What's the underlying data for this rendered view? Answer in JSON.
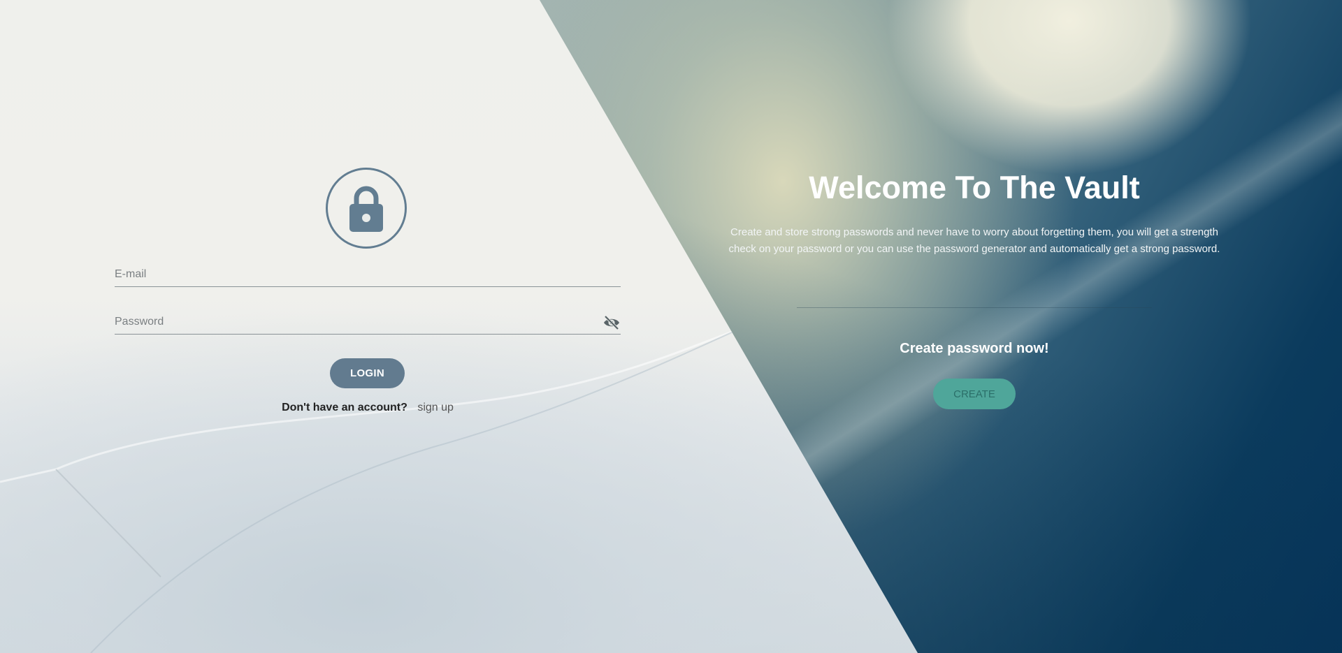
{
  "login": {
    "email_placeholder": "E-mail",
    "password_placeholder": "Password",
    "login_label": "LOGIN",
    "no_account_text": "Don't have an account?",
    "signup_label": "sign up",
    "accent_color": "#627b8f"
  },
  "welcome": {
    "title": "Welcome To The Vault",
    "description": "Create and store strong passwords and never have to worry about forgetting them, you will get a strength check on your password or you can use the password generator and automatically get a strong password.",
    "create_heading": "Create password now!",
    "create_label": "CREATE",
    "create_color": "#4fa69a"
  },
  "icons": {
    "lock": "lock-icon",
    "visibility_toggle": "eye-off-icon"
  }
}
